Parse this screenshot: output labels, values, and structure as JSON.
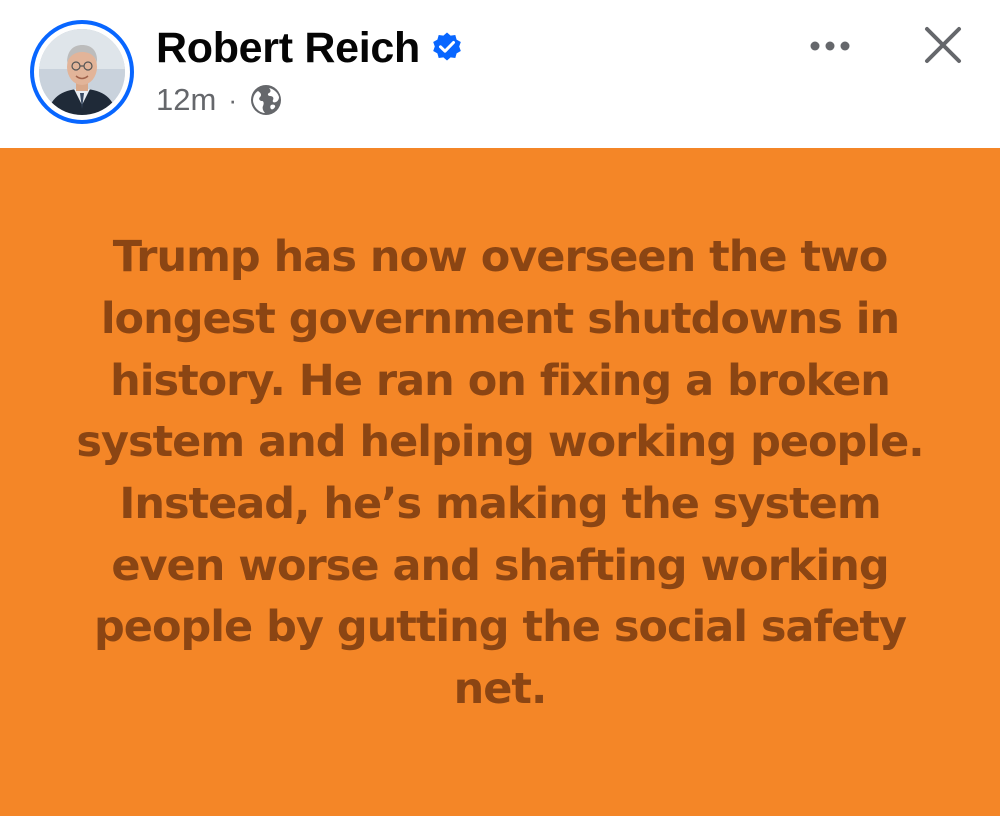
{
  "post": {
    "author_name": "Robert Reich",
    "verified": true,
    "timestamp": "12m",
    "separator": "·",
    "audience_icon": "globe-icon",
    "more_icon": "more-options-icon",
    "close_icon": "close-icon",
    "avatar_icon": "profile-photo",
    "background_color": "#f48627",
    "text_color": "#8b4513",
    "text": "Trump has now overseen the two longest government shutdowns in history. He ran on fixing a broken system and helping working people. Instead, he’s making the system even worse and shafting working people by gutting the social safety net."
  },
  "colors": {
    "verified_blue": "#0866ff",
    "secondary_text": "#65676b",
    "primary_text": "#050505"
  }
}
